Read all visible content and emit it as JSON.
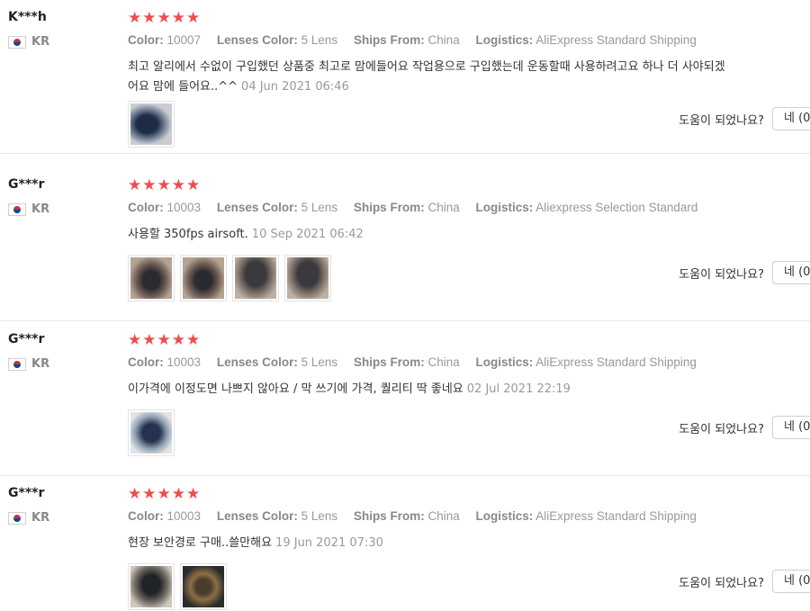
{
  "meta_labels": {
    "color": "Color:",
    "lenses_color": "Lenses Color:",
    "ships_from": "Ships From:",
    "logistics": "Logistics:"
  },
  "helpful_label": "도움이 되었나요?",
  "yes_label": "네 (0",
  "star_color": "#f14b4b",
  "reviews": [
    {
      "user": "K***h",
      "country": "KR",
      "stars": 5,
      "color": "10007",
      "lenses_color": "5 Lens",
      "ships_from": "China",
      "logistics": "AliExpress Standard Shipping",
      "text_line1": "최고 알리에서 수없이 구입했던 상품중 최고로 맘에들어요 작업용으로 구입했는데 운동할때 사용하려고요 하나 더 사야되겠",
      "text_line2": "어요 맘에 들어요..^^",
      "date": "04 Jun 2021 06:46"
    },
    {
      "user": "G***r",
      "country": "KR",
      "stars": 5,
      "color": "10003",
      "lenses_color": "5 Lens",
      "ships_from": "China",
      "logistics": "Aliexpress Selection Standard",
      "text_line1": "사용할 350fps airsoft.",
      "date": "10 Sep 2021 06:42"
    },
    {
      "user": "G***r",
      "country": "KR",
      "stars": 5,
      "color": "10003",
      "lenses_color": "5 Lens",
      "ships_from": "China",
      "logistics": "AliExpress Standard Shipping",
      "text_line1": "이가격에 이정도면 나쁘지 않아요 / 막 쓰기에 가격, 퀄리티 딱 좋네요",
      "date": "02 Jul 2021 22:19"
    },
    {
      "user": "G***r",
      "country": "KR",
      "stars": 5,
      "color": "10003",
      "lenses_color": "5 Lens",
      "ships_from": "China",
      "logistics": "AliExpress Standard Shipping",
      "text_line1": "현장 보안경로 구매..쓸만해요",
      "date": "19 Jun 2021 07:30"
    }
  ]
}
